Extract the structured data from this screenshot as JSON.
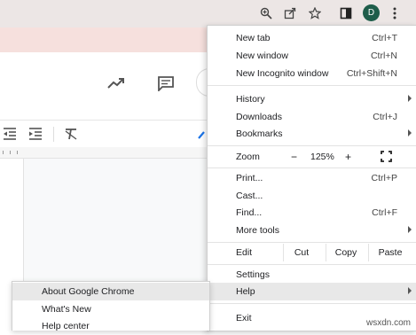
{
  "browser": {
    "toolbar_icons": [
      "zoom-icon",
      "share-icon",
      "star-icon",
      "side-panel-icon",
      "kebab-menu-icon"
    ],
    "avatar_letter": "D"
  },
  "docs": {
    "toolbar_icons": [
      "trending-icon",
      "comment-icon"
    ],
    "format_icons": [
      "decrease-indent-icon",
      "increase-indent-icon",
      "clear-formatting-icon"
    ]
  },
  "menu": {
    "new_tab": {
      "label": "New tab",
      "shortcut": "Ctrl+T"
    },
    "new_window": {
      "label": "New window",
      "shortcut": "Ctrl+N"
    },
    "new_incognito": {
      "label": "New Incognito window",
      "shortcut": "Ctrl+Shift+N"
    },
    "history": {
      "label": "History"
    },
    "downloads": {
      "label": "Downloads",
      "shortcut": "Ctrl+J"
    },
    "bookmarks": {
      "label": "Bookmarks"
    },
    "zoom": {
      "label": "Zoom",
      "minus": "−",
      "value": "125%",
      "plus": "+"
    },
    "print": {
      "label": "Print...",
      "shortcut": "Ctrl+P"
    },
    "cast": {
      "label": "Cast..."
    },
    "find": {
      "label": "Find...",
      "shortcut": "Ctrl+F"
    },
    "more_tools": {
      "label": "More tools"
    },
    "edit": {
      "label": "Edit",
      "cut": "Cut",
      "copy": "Copy",
      "paste": "Paste"
    },
    "settings": {
      "label": "Settings"
    },
    "help": {
      "label": "Help"
    },
    "exit": {
      "label": "Exit"
    }
  },
  "help_submenu": {
    "about": "About Google Chrome",
    "whats_new": "What's New",
    "help_center": "Help center"
  },
  "watermark": "wsxdn.com"
}
